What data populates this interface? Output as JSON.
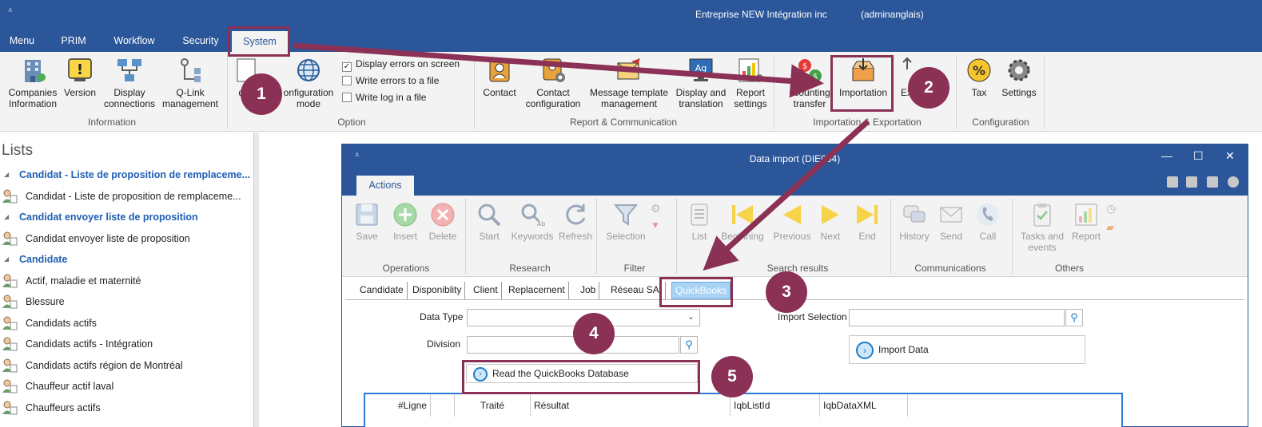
{
  "app": {
    "company": "Entreprise NEW Intégration inc",
    "user": "(adminanglais)",
    "quick_access": "⩡"
  },
  "menu_tabs": [
    "Menu",
    "PRIM",
    "Workflow",
    "Security",
    "System"
  ],
  "ribbon": {
    "information": {
      "label": "Information",
      "companies": "Companies\nInformation",
      "version": "Version",
      "display_connections": "Display\nconnections",
      "qlink": "Q-Link\nmanagement"
    },
    "option": {
      "label": "Option",
      "quick_cut": "qu",
      "configuration_mode": "onfiguration\nmode",
      "chk_display_errors": "Display errors on screen",
      "chk_write_errors": "Write errors to a file",
      "chk_write_log": "Write log in a file"
    },
    "report": {
      "label": "Report & Communication",
      "contact": "Contact",
      "contact_config": "Contact\nconfiguration",
      "message_template": "Message template\nmanagement",
      "display_translation": "Display and\ntranslation",
      "report_settings": "Report\nsettings"
    },
    "import_export": {
      "label": "Importation & Exportation",
      "accounting_transfer": "ccounting\ntransfer",
      "importation": "Importation",
      "exportation_cut": "Ex"
    },
    "configuration": {
      "label": "Configuration",
      "tax": "Tax",
      "settings": "Settings"
    }
  },
  "lists": {
    "title": "Lists",
    "items": [
      {
        "type": "hdr",
        "label": "Candidat - Liste de proposition de remplaceme..."
      },
      {
        "type": "row",
        "label": "Candidat - Liste de proposition de remplaceme..."
      },
      {
        "type": "hdr",
        "label": "Candidat envoyer liste de proposition"
      },
      {
        "type": "row",
        "label": "Candidat envoyer liste de proposition"
      },
      {
        "type": "hdr",
        "label": "Candidate"
      },
      {
        "type": "row",
        "label": "Actif, maladie et maternité"
      },
      {
        "type": "row",
        "label": "Blessure"
      },
      {
        "type": "row",
        "label": "Candidats actifs"
      },
      {
        "type": "row",
        "label": "Candidats actifs - Intégration"
      },
      {
        "type": "row",
        "label": "Candidats actifs région de Montréal"
      },
      {
        "type": "row",
        "label": "Chauffeur actif laval"
      },
      {
        "type": "row",
        "label": "Chauffeurs actifs"
      }
    ]
  },
  "window": {
    "title": "Data import (DIE004)",
    "tab": "Actions",
    "minimize": "—",
    "maximize": "☐",
    "close": "✕",
    "groups": {
      "operations": "Operations",
      "research": "Research",
      "filter": "Filter",
      "search_results": "Search results",
      "communications": "Communications",
      "others": "Others"
    },
    "buttons": {
      "save": "Save",
      "insert": "Insert",
      "delete": "Delete",
      "start": "Start",
      "keywords": "Keywords",
      "refresh": "Refresh",
      "selection": "Selection",
      "list": "List",
      "beginning": "Beginning",
      "previous": "Previous",
      "next": "Next",
      "end": "End",
      "history": "History",
      "send": "Send",
      "call": "Call",
      "tasks_events": "Tasks and\nevents",
      "report": "Report"
    },
    "subtabs": [
      "Candidate",
      "Disponiblity",
      "Client",
      "Replacement",
      "Job",
      "Réseau SAI",
      "QuickBooks"
    ],
    "form": {
      "data_type_label": "Data Type",
      "division_label": "Division",
      "import_selection_label": "Import Selection",
      "import_data": "Import Data",
      "read_qb": "Read the QuickBooks Database"
    },
    "grid_headers": [
      "#Ligne",
      "",
      "Traité",
      "Résultat",
      "IqbListId",
      "IqbDataXML"
    ]
  },
  "annotations": [
    "1",
    "2",
    "3",
    "4",
    "5"
  ],
  "colors": {
    "title_blue": "#2b579a",
    "annotation": "#8a3155",
    "link_blue": "#1f5fb4",
    "active_subtab": "#a8d3f5"
  }
}
